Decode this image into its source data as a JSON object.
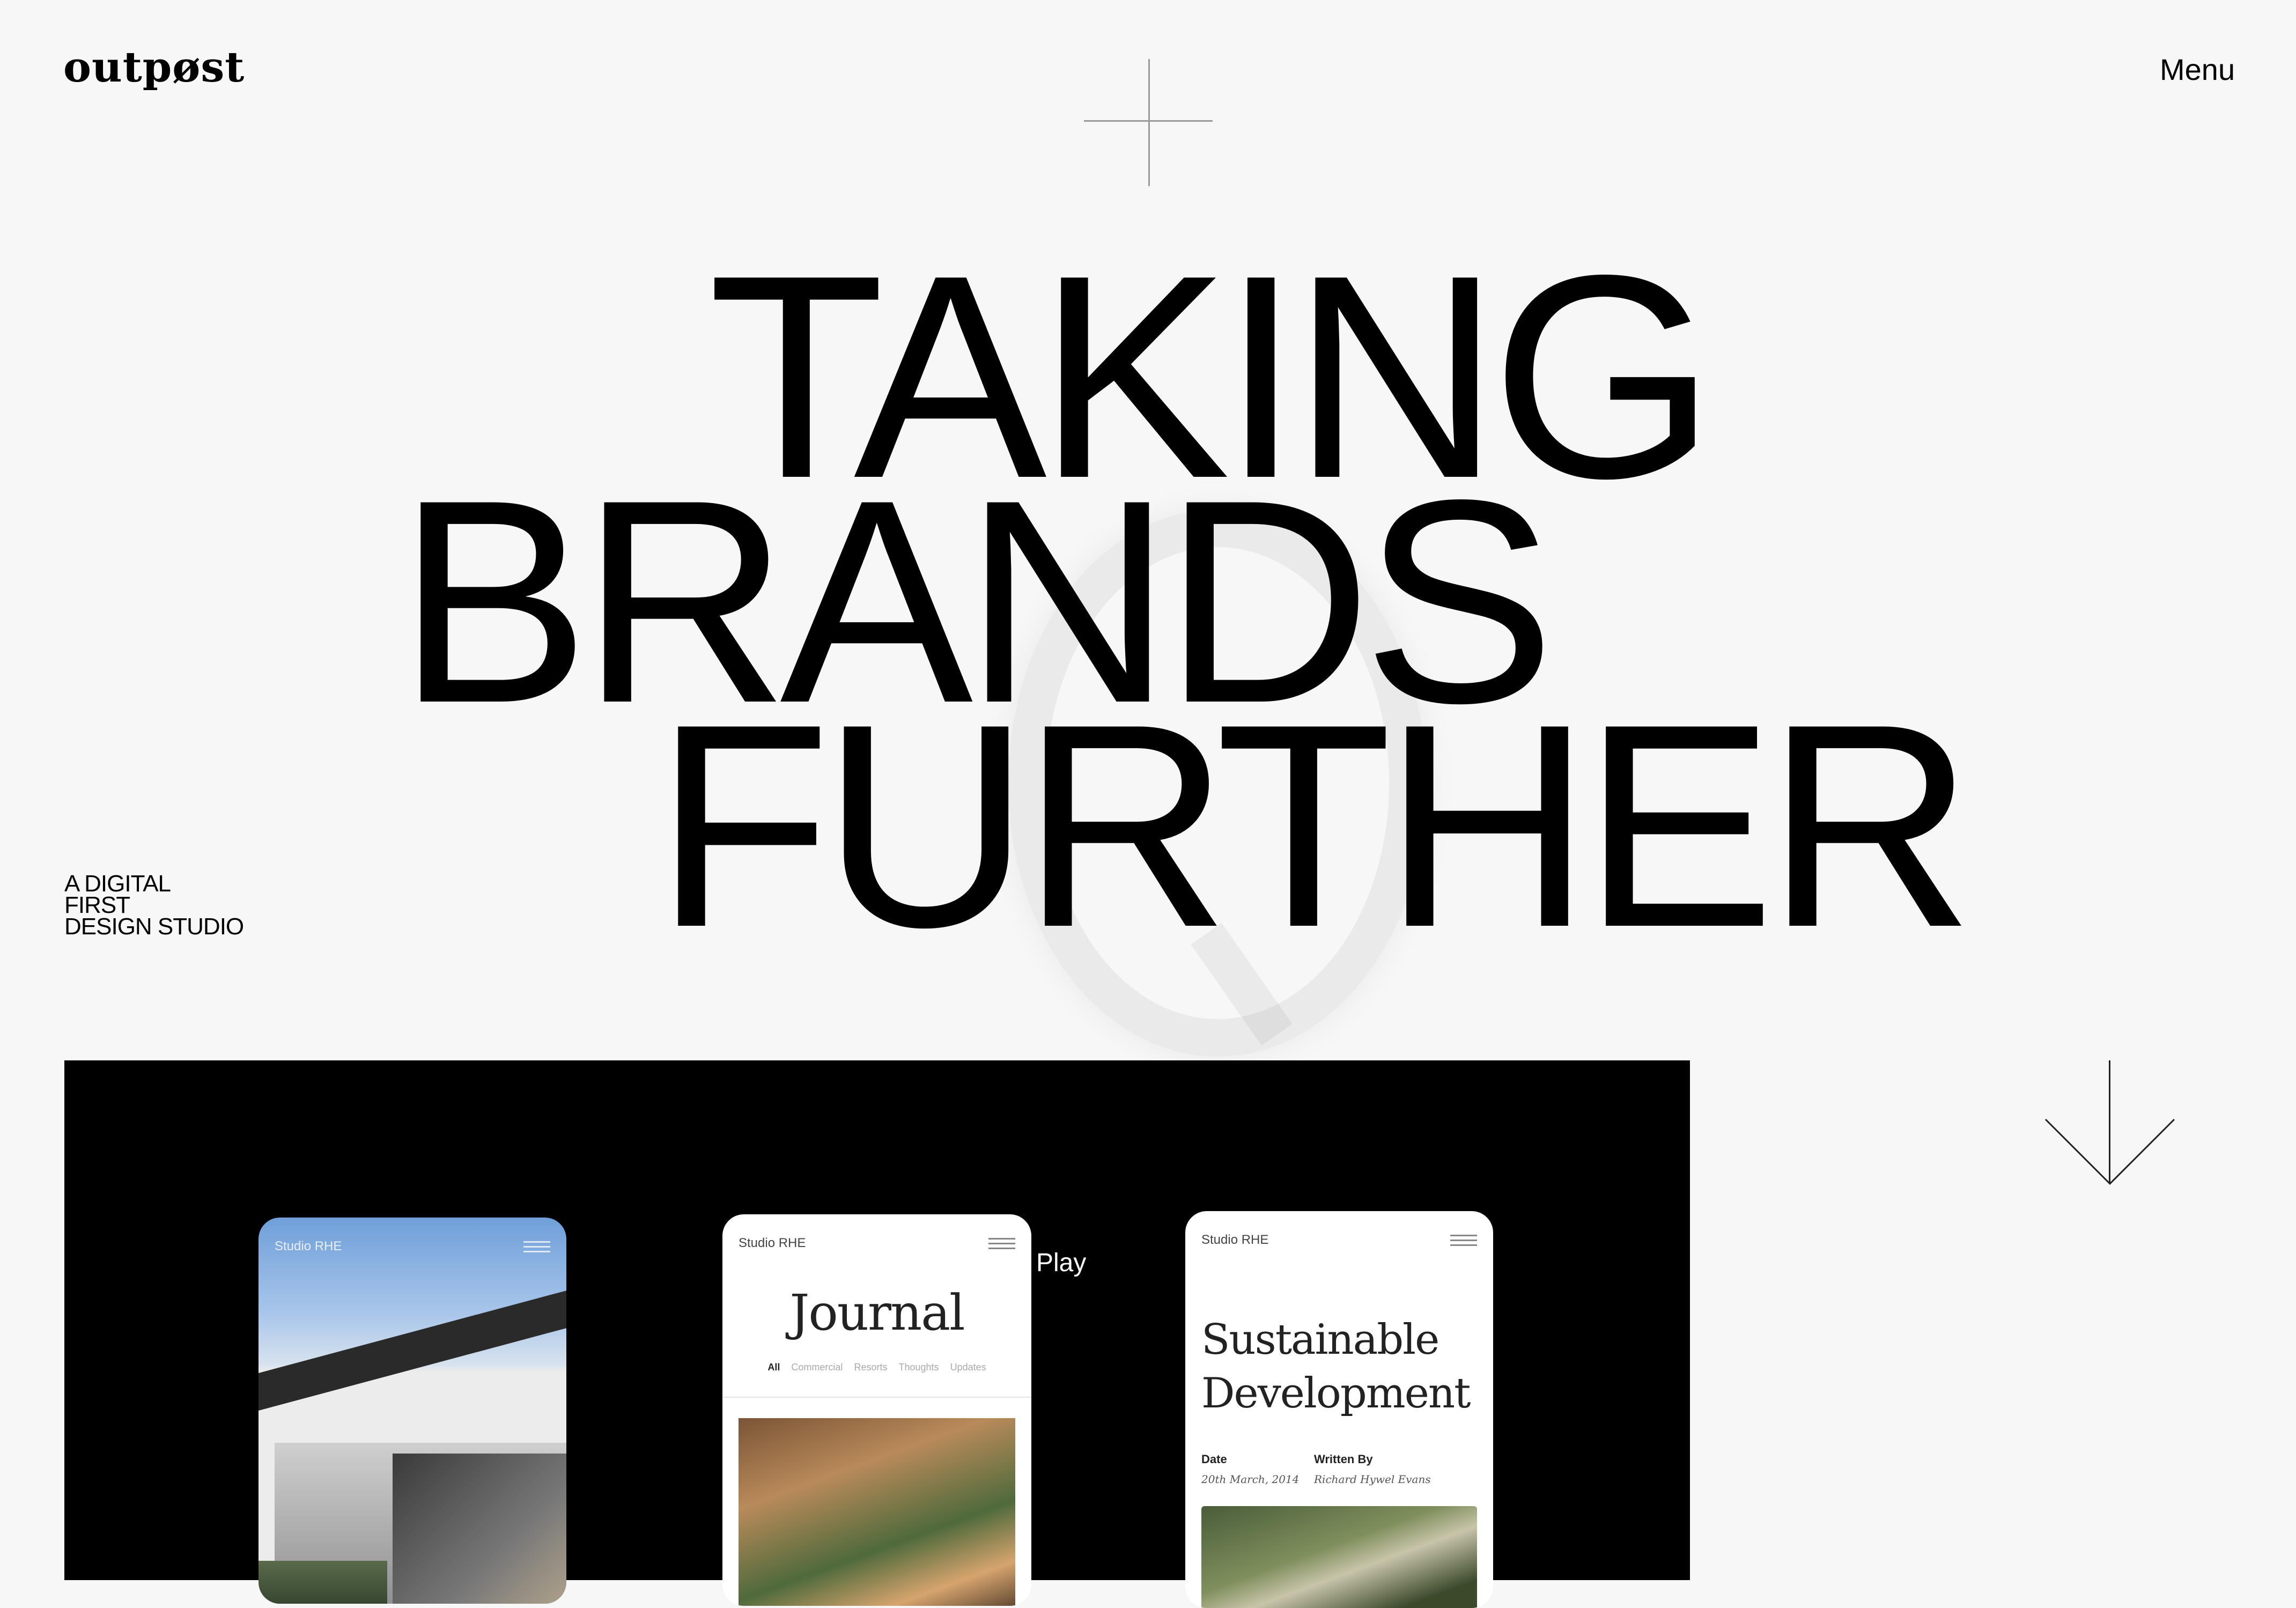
{
  "header": {
    "logo": "outpøst",
    "menu_label": "Menu"
  },
  "hero": {
    "line1": "TAKING",
    "line2": "BRANDS",
    "line3": "FURTHER"
  },
  "tagline": {
    "line1": "A DIGITAL",
    "line2": "FIRST",
    "line3": "DESIGN STUDIO"
  },
  "video": {
    "play_label": "Play",
    "phones": [
      {
        "brand": "Studio RHE"
      },
      {
        "brand": "Studio RHE",
        "title": "Journal",
        "filters": [
          "All",
          "Commercial",
          "Resorts",
          "Thoughts",
          "Updates"
        ]
      },
      {
        "brand": "Studio RHE",
        "title_line1": "Sustainable",
        "title_line2": "Development",
        "date_label": "Date",
        "date_value": "20th March, 2014",
        "author_label": "Written By",
        "author_value": "Richard Hywel Evans"
      }
    ]
  },
  "icons": {
    "scroll": "arrow-down-icon",
    "menu": "hamburger-icon"
  },
  "colors": {
    "background": "#f7f7f7",
    "text": "#000000",
    "video_bg": "#000000"
  }
}
